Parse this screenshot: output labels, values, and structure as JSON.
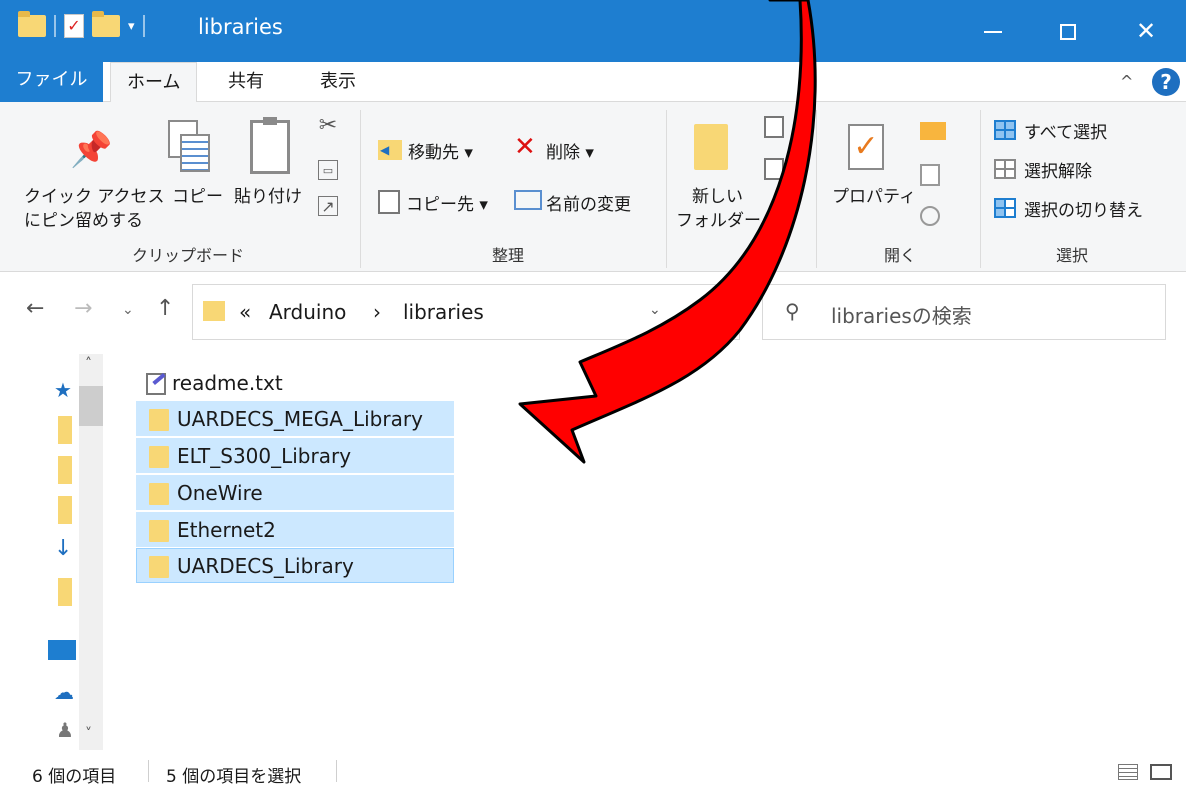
{
  "window": {
    "title": "libraries",
    "accent_color": "#1e7ed0",
    "minimize_icon": "minimize-icon",
    "maximize_icon": "maximize-icon",
    "close_glyph": "✕"
  },
  "ribbon_tabs": {
    "file": "ファイル",
    "home": "ホーム",
    "share": "共有",
    "view": "表示",
    "collapse_glyph": "^",
    "help_glyph": "?"
  },
  "ribbon": {
    "clipboard": {
      "label": "クリップボード",
      "pin_line1": "クイック アクセス",
      "pin_line2": "にピン留めする",
      "copy": "コピー",
      "paste": "貼り付け"
    },
    "organize": {
      "label": "整理",
      "move_to": "移動先 ▾",
      "copy_to": "コピー先 ▾",
      "delete": "削除 ▾",
      "rename": "名前の変更"
    },
    "new": {
      "new_folder_line1": "新しい",
      "new_folder_line2": "フォルダー"
    },
    "open": {
      "label": "開く",
      "properties": "プロパティ"
    },
    "select": {
      "label": "選択",
      "select_all": "すべて選択",
      "select_none": "選択解除",
      "invert": "選択の切り替え"
    }
  },
  "address": {
    "overflow": "«",
    "crumb1": "Arduino",
    "separator": "›",
    "crumb2": "libraries",
    "search_placeholder": "librariesの検索"
  },
  "files": [
    {
      "name": "readme.txt",
      "icon": "text-file-icon",
      "selected": false
    },
    {
      "name": "UARDECS_MEGA_Library",
      "icon": "folder-icon",
      "selected": true
    },
    {
      "name": "ELT_S300_Library",
      "icon": "folder-icon",
      "selected": true
    },
    {
      "name": "OneWire",
      "icon": "folder-icon",
      "selected": true
    },
    {
      "name": "Ethernet2",
      "icon": "folder-icon",
      "selected": true
    },
    {
      "name": "UARDECS_Library",
      "icon": "folder-icon",
      "selected": true
    }
  ],
  "status": {
    "item_count": "6 個の項目",
    "selected_count": "5 個の項目を選択"
  },
  "colors": {
    "selection_bg": "#cce8ff",
    "folder": "#f8d775",
    "annotation_arrow": "#ff0000"
  }
}
